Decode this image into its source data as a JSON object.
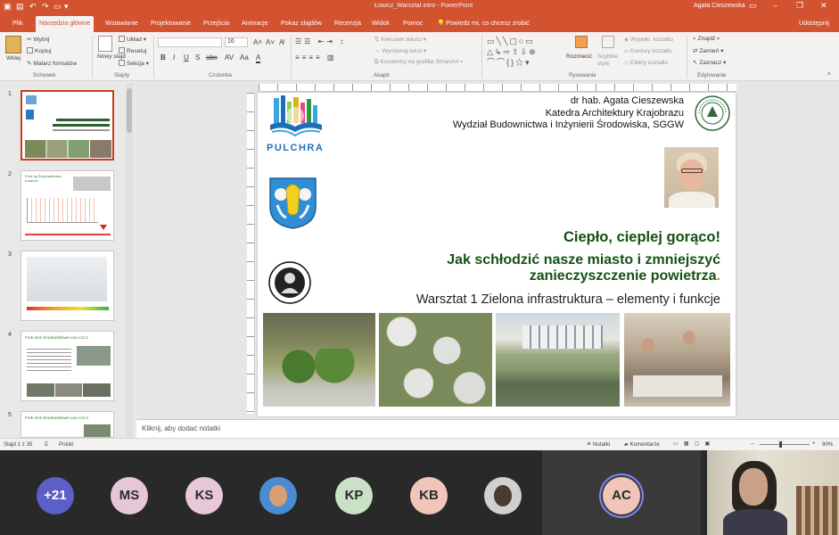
{
  "titlebar": {
    "filename": "Łowicz_Warsztat intro - PowerPoint",
    "user": "Agata Cieszewska"
  },
  "tabs": [
    {
      "label": "Plik",
      "active": false
    },
    {
      "label": "Narzędzia główne",
      "active": true
    },
    {
      "label": "Wstawianie",
      "active": false
    },
    {
      "label": "Projektowanie",
      "active": false
    },
    {
      "label": "Przejścia",
      "active": false
    },
    {
      "label": "Animacje",
      "active": false
    },
    {
      "label": "Pokaz slajdów",
      "active": false
    },
    {
      "label": "Recenzja",
      "active": false
    },
    {
      "label": "Widok",
      "active": false
    },
    {
      "label": "Pomoc",
      "active": false
    }
  ],
  "tell_me": "Powiedz mi, co chcesz zrobić",
  "share": "Udostępnij",
  "ribbon": {
    "paste": "Wklej",
    "cut": "Wytnij",
    "copy": "Kopiuj",
    "format_painter": "Malarz formatów",
    "new_slide": "Nowy slajd",
    "layout": "Układ",
    "reset": "Resetuj",
    "section": "Sekcja",
    "font_size": "16",
    "text_direction": "Kierunek tekstu",
    "align_text": "Wyrównaj tekst",
    "smartart": "Konwertuj na grafikę SmartArt",
    "arrange": "Rozmieść",
    "quick_styles": "Szybkie style",
    "shape_fill": "Wypełn. kształtu",
    "shape_outline": "Kontury kształtu",
    "shape_effects": "Efekty kształtu",
    "find": "Znajdź",
    "replace": "Zamień",
    "select": "Zaznacz",
    "groups": {
      "clipboard": "Schowek",
      "slides": "Slajdy",
      "font": "Czcionka",
      "paragraph": "Akapit",
      "drawing": "Rysowanie",
      "editing": "Edytowanie"
    }
  },
  "thumbnails": [
    {
      "num": "1",
      "selected": true
    },
    {
      "num": "2",
      "selected": false,
      "title": "Frob ng Środowiskowe Łowicza"
    },
    {
      "num": "3",
      "selected": false
    },
    {
      "num": "4",
      "selected": false,
      "title": "Frob ems Środowiskowe Łow cza 2"
    },
    {
      "num": "5",
      "selected": false,
      "title": "Frob ems Środowiskowe Łow cza 3"
    }
  ],
  "slide": {
    "author_line1": "dr  hab. Agata Cieszewska",
    "author_line2": "Katedra Architektury Krajobrazu",
    "author_line3": "Wydział Budownictwa i Inżynierii Środowiska, SGGW",
    "logo_text": "PULCHRA",
    "title1": "Ciepło, cieplej gorąco!",
    "title2a": "Jak schłodzić nasze miasto i zmniejszyć",
    "title2b": "zanieczyszczenie powietrza",
    "title2b_dot": ".",
    "title3": "Warsztat 1 Zielona infrastruktura – elementy i funkcje"
  },
  "notes_placeholder": "Kliknij, aby dodać notatki",
  "status": {
    "slide_counter": "Slajd 1 z 35",
    "language": "Polski",
    "notes": "Notatki",
    "comments": "Komentarze",
    "zoom": "90%"
  },
  "participants": [
    {
      "initials": "+21",
      "color": "#5b5fc7",
      "text_color": "#ffffff"
    },
    {
      "initials": "MS",
      "color": "#e5c7d9"
    },
    {
      "initials": "KS",
      "color": "#e8c8d6"
    },
    {
      "initials": "",
      "photo": true,
      "color": "#4b8bd1"
    },
    {
      "initials": "KP",
      "color": "#c9e2c5"
    },
    {
      "initials": "KB",
      "color": "#efc6b9"
    },
    {
      "initials": "",
      "photo": true,
      "color": "#d0d0d0"
    },
    {
      "initials": "AC",
      "color": "#efc6b9",
      "speaking": true
    }
  ]
}
